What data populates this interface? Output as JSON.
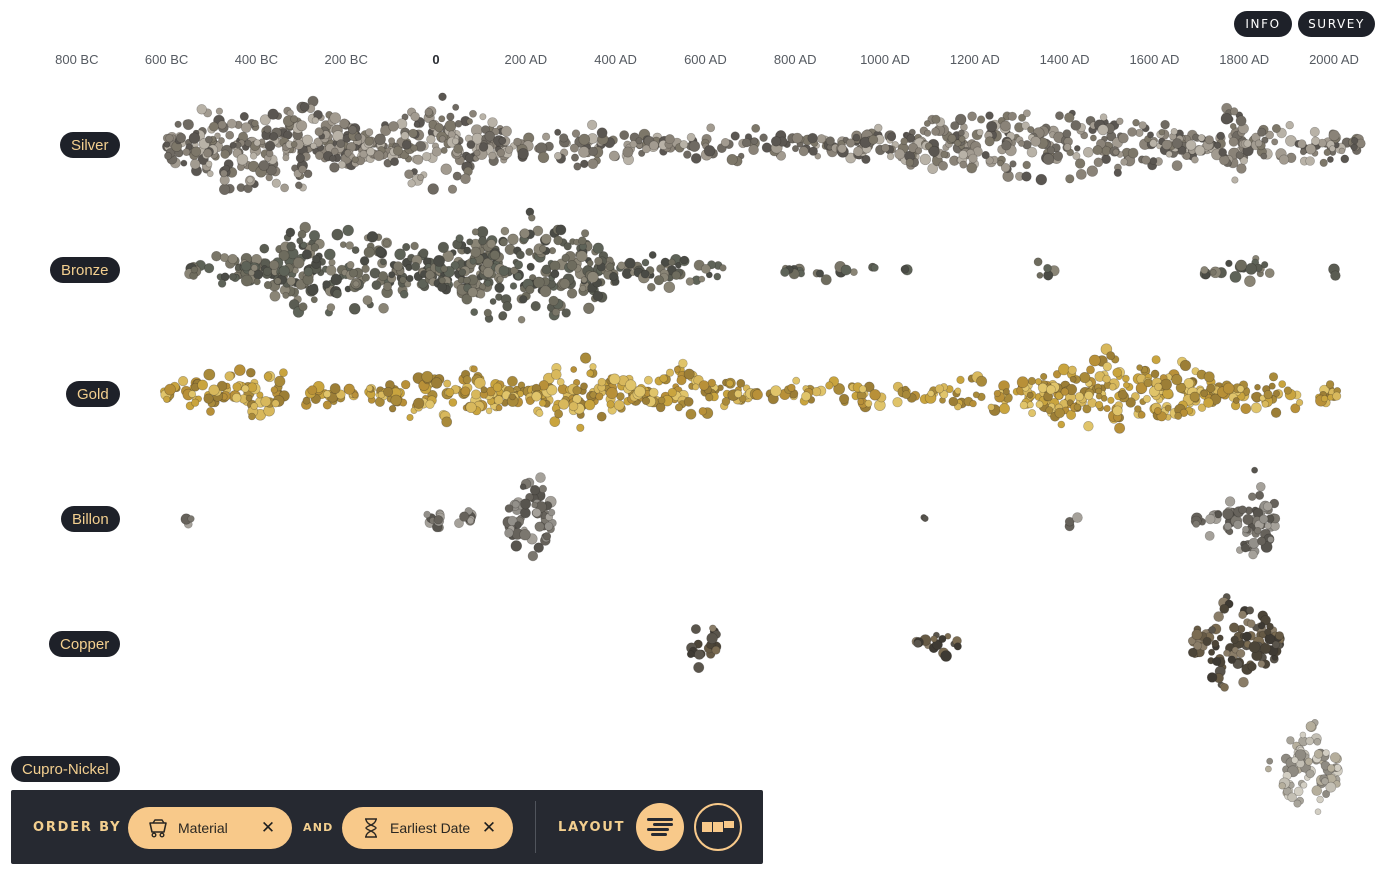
{
  "header": {
    "info_label": "INFO",
    "survey_label": "SURVEY"
  },
  "timeline": {
    "ticks": [
      {
        "label": "800 BC",
        "year": -800
      },
      {
        "label": "600 BC",
        "year": -600
      },
      {
        "label": "400 BC",
        "year": -400
      },
      {
        "label": "200 BC",
        "year": -200
      },
      {
        "label": "0",
        "year": 0
      },
      {
        "label": "200 AD",
        "year": 200
      },
      {
        "label": "400 AD",
        "year": 400
      },
      {
        "label": "600 AD",
        "year": 600
      },
      {
        "label": "800 AD",
        "year": 800
      },
      {
        "label": "1000 AD",
        "year": 1000
      },
      {
        "label": "1200 AD",
        "year": 1200
      },
      {
        "label": "1400 AD",
        "year": 1400
      },
      {
        "label": "1600 AD",
        "year": 1600
      },
      {
        "label": "1800 AD",
        "year": 1800
      },
      {
        "label": "2000 AD",
        "year": 2000
      }
    ]
  },
  "materials": [
    {
      "name": "Silver",
      "palette": [
        "#8a8378",
        "#a29b90",
        "#6f6a62",
        "#5a5651",
        "#b8b2a7",
        "#7d7769"
      ],
      "clusters": [
        {
          "start": -600,
          "end": -150,
          "density": 0.85
        },
        {
          "start": -150,
          "end": 160,
          "density": 0.75
        },
        {
          "start": 160,
          "end": 500,
          "density": 0.3
        },
        {
          "start": 500,
          "end": 900,
          "density": 0.25
        },
        {
          "start": 900,
          "end": 1750,
          "density": 0.55
        },
        {
          "start": 1750,
          "end": 1800,
          "density": 0.95
        },
        {
          "start": 1800,
          "end": 2060,
          "density": 0.35
        }
      ]
    },
    {
      "name": "Bronze",
      "palette": [
        "#5a5c52",
        "#6e6c5e",
        "#4a4b45",
        "#7a7668",
        "#5e6358",
        "#8a8576"
      ],
      "clusters": [
        {
          "start": -550,
          "end": -430,
          "density": 0.25
        },
        {
          "start": -430,
          "end": 0,
          "density": 0.75
        },
        {
          "start": 0,
          "end": 400,
          "density": 0.95
        },
        {
          "start": 400,
          "end": 640,
          "density": 0.25
        },
        {
          "start": 760,
          "end": 1050,
          "density": 0.08
        },
        {
          "start": 1300,
          "end": 1400,
          "density": 0.04
        },
        {
          "start": 1710,
          "end": 1860,
          "density": 0.18
        },
        {
          "start": 2000,
          "end": 2010,
          "density": 0.06
        }
      ]
    },
    {
      "name": "Gold",
      "palette": [
        "#c9a43e",
        "#b89038",
        "#d8b85c",
        "#a98a3a",
        "#e0c46a",
        "#9c7e36"
      ],
      "clusters": [
        {
          "start": -610,
          "end": -180,
          "density": 0.35
        },
        {
          "start": -150,
          "end": 200,
          "density": 0.45
        },
        {
          "start": 200,
          "end": 450,
          "density": 0.55
        },
        {
          "start": 450,
          "end": 700,
          "density": 0.45
        },
        {
          "start": 700,
          "end": 1100,
          "density": 0.18
        },
        {
          "start": 1100,
          "end": 1300,
          "density": 0.25
        },
        {
          "start": 1300,
          "end": 1750,
          "density": 0.7
        },
        {
          "start": 1750,
          "end": 2010,
          "density": 0.3
        }
      ]
    },
    {
      "name": "Billon",
      "palette": [
        "#7b776f",
        "#93908a",
        "#66625b",
        "#a5a19a",
        "#57544e"
      ],
      "clusters": [
        {
          "start": -560,
          "end": -545,
          "density": 0.05
        },
        {
          "start": -20,
          "end": 80,
          "density": 0.25
        },
        {
          "start": 160,
          "end": 260,
          "density": 0.8
        },
        {
          "start": 1080,
          "end": 1090,
          "density": 0.03
        },
        {
          "start": 1400,
          "end": 1440,
          "density": 0.04
        },
        {
          "start": 1690,
          "end": 1750,
          "density": 0.2
        },
        {
          "start": 1760,
          "end": 1870,
          "density": 0.8
        }
      ]
    },
    {
      "name": "Copper",
      "palette": [
        "#4c4538",
        "#665a45",
        "#3e3a33",
        "#7b6c52",
        "#8a7d68",
        "#5a554c"
      ],
      "clusters": [
        {
          "start": 560,
          "end": 630,
          "density": 0.35
        },
        {
          "start": 1070,
          "end": 1170,
          "density": 0.2
        },
        {
          "start": 1680,
          "end": 1880,
          "density": 0.75
        }
      ]
    },
    {
      "name": "Cupro-Nickel",
      "palette": [
        "#a8a49a",
        "#c3bfb4",
        "#8f8b82",
        "#d2cec3",
        "#b5ae9c"
      ],
      "clusters": [
        {
          "start": 1850,
          "end": 1860,
          "density": 0.05
        },
        {
          "start": 1880,
          "end": 2010,
          "density": 0.85
        }
      ]
    }
  ],
  "toolbar": {
    "order_by_label": "ORDER BY",
    "and_label": "AND",
    "layout_label": "LAYOUT",
    "chips": [
      {
        "label": "Material",
        "icon": "cart-icon",
        "remove_icon": "close-icon"
      },
      {
        "label": "Earliest Date",
        "icon": "hourglass-icon",
        "remove_icon": "close-icon"
      }
    ],
    "layout_options": [
      {
        "name": "swarm",
        "selected": true
      },
      {
        "name": "grid",
        "selected": false
      }
    ]
  },
  "colors": {
    "label_bg": "#1e2129",
    "label_text": "#f3cf8f",
    "toolbar_bg": "#262931",
    "chip_bg": "#f8c98a"
  }
}
